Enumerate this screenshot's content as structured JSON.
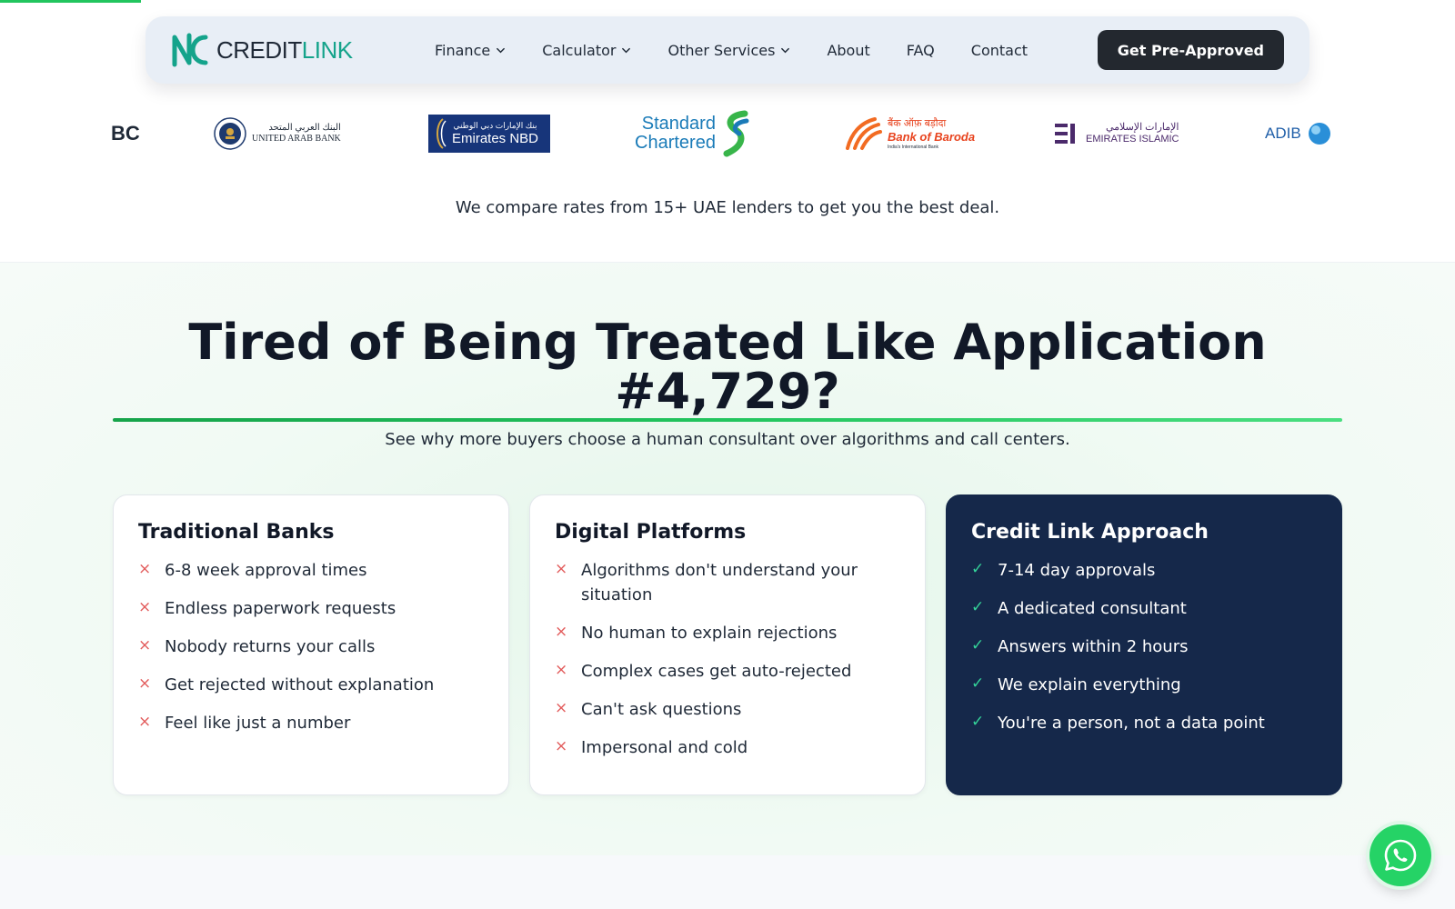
{
  "progress": {
    "fraction": 0.097
  },
  "header": {
    "logo": {
      "credit": "CREDIT",
      "link": "LINK"
    },
    "nav": [
      {
        "label": "Finance",
        "dropdown": true
      },
      {
        "label": "Calculator",
        "dropdown": true
      },
      {
        "label": "Other Services",
        "dropdown": true
      },
      {
        "label": "About",
        "dropdown": false
      },
      {
        "label": "FAQ",
        "dropdown": false
      },
      {
        "label": "Contact",
        "dropdown": false
      }
    ],
    "cta_label": "Get Pre-Approved"
  },
  "lenders": {
    "hsbc_partial": "BC",
    "uab_arabic": "البنك العربي المتحد",
    "uab_english": "UNITED ARAB BANK",
    "enbd_arabic": "بنك الإمارات دبي الوطني",
    "enbd_english": "Emirates NBD",
    "sc_line1": "Standard",
    "sc_line2": "Chartered",
    "bob_hindi": "बैंक ऑफ़ बड़ौदा",
    "bob_english": "Bank of Baroda",
    "bob_tagline": "India's International Bank",
    "ei_arabic": "الإمارات الإسلامي",
    "ei_english": "EMIRATES ISLAMIC",
    "adib": "ADIB"
  },
  "compare_text": "We compare rates from 15+ UAE lenders to get you the best deal.",
  "comparison": {
    "title": "Tired of Being Treated Like Application #4,729?",
    "subtitle": "See why more buyers choose a human consultant over algorithms and call centers.",
    "cards": [
      {
        "title": "Traditional Banks",
        "items": [
          "6-8 week approval times",
          "Endless paperwork requests",
          "Nobody returns your calls",
          "Get rejected without explanation",
          "Feel like just a number"
        ]
      },
      {
        "title": "Digital Platforms",
        "items": [
          "Algorithms don't understand your situation",
          "No human to explain rejections",
          "Complex cases get auto-rejected",
          "Can't ask questions",
          "Impersonal and cold"
        ]
      },
      {
        "title": "Credit Link Approach",
        "items": [
          "7-14 day approvals",
          "A dedicated consultant",
          "Answers within 2 hours",
          "We explain everything",
          "You're a person, not a data point"
        ]
      }
    ]
  },
  "icons": {
    "negative": "×",
    "positive": "✓",
    "whatsapp": "whatsapp-icon"
  },
  "colors": {
    "accent_green": "#22c55e",
    "logo_teal": "#14a38b",
    "dark_card": "#15284a",
    "cta_dark": "#23282f",
    "x_red": "#e25a5a",
    "check_green": "#34d399",
    "whatsapp_green": "#25d366"
  }
}
